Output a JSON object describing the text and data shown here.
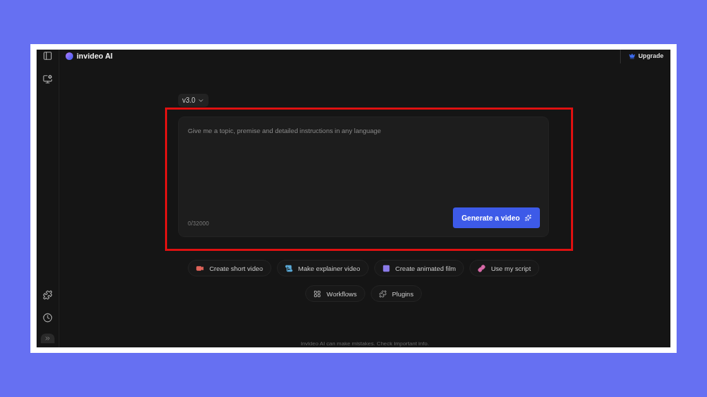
{
  "header": {
    "title": "invideo AI",
    "upgrade": "Upgrade"
  },
  "version": {
    "label": "v3.0"
  },
  "prompt": {
    "placeholder": "Give me a topic, premise and detailed instructions in any language",
    "counter": "0/32000",
    "button": "Generate a video"
  },
  "quick_actions": [
    {
      "kind": "short",
      "label": "Create short video",
      "color": "#e0645a"
    },
    {
      "kind": "explainer",
      "label": "Make explainer video",
      "color": "#5aa9d6"
    },
    {
      "kind": "animated",
      "label": "Create animated film",
      "color": "#8b7be8"
    },
    {
      "kind": "script",
      "label": "Use my script",
      "color": "#d86aa8"
    }
  ],
  "secondary_actions": [
    {
      "kind": "workflows",
      "label": "Workflows"
    },
    {
      "kind": "plugins",
      "label": "Plugins"
    }
  ],
  "footer_note": "invideo AI can make mistakes. Check important info."
}
